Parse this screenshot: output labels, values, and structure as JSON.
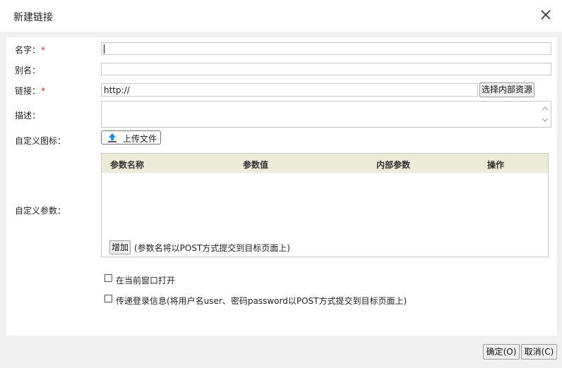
{
  "dialog": {
    "title": "新建链接",
    "close_icon": "close-icon"
  },
  "form": {
    "name": {
      "label": "名字：",
      "required_mark": "*",
      "value": ""
    },
    "alias": {
      "label": "别名：",
      "value": ""
    },
    "link": {
      "label": "链接：",
      "required_mark": "*",
      "value": "http://",
      "select_resource_label": "选择内部资源"
    },
    "description": {
      "label": "描述：",
      "value": ""
    },
    "custom_icon": {
      "label": "自定义图标：",
      "upload_label": "上传文件",
      "upload_icon": "upload-icon"
    },
    "custom_params": {
      "label": "自定义参数：",
      "columns": [
        "参数名称",
        "参数值",
        "内部参数",
        "操作"
      ],
      "rows": [],
      "add_label": "增加",
      "hint": "(参数名将以POST方式提交到目标页面上)"
    },
    "open_current_window": {
      "label": "在当前窗口打开",
      "checked": false
    },
    "pass_login": {
      "label": "传递登录信息(将用户名user、密码password以POST方式提交到目标页面上)",
      "checked": false
    }
  },
  "footer": {
    "ok_label": "确定(O)",
    "cancel_label": "取消(C)"
  },
  "colors": {
    "required": "#e02020",
    "table_header_bg": "#ecebd7",
    "upload_arrow": "#1e88e5"
  }
}
